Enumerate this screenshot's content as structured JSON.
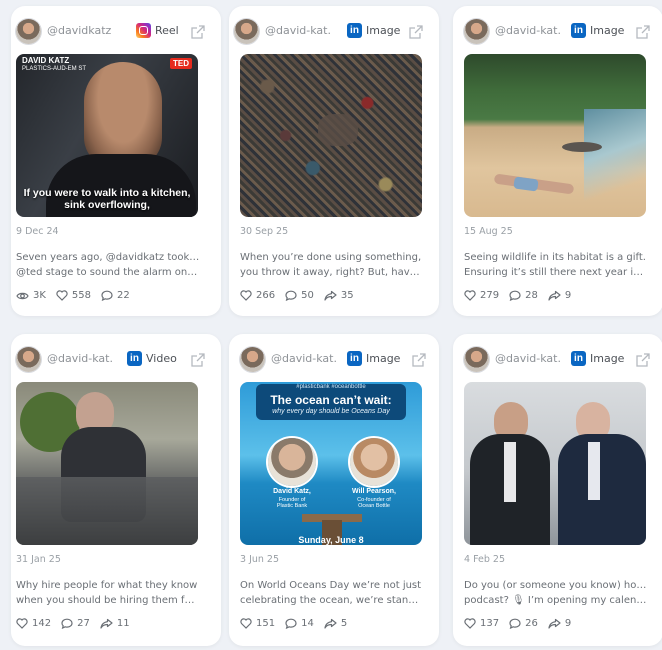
{
  "posts": [
    {
      "handle": "@davidkatz",
      "platform": "Reel",
      "platform_icon": "instagram-icon",
      "date": "9 Dec 24",
      "caption_lines": [
        "Seven years ago, @davidkatz took the",
        "@ted stage to sound the alarm on th..."
      ],
      "views": "3K",
      "likes": "558",
      "comments": "22",
      "media": {
        "speaker_name": "DAVID KATZ",
        "speaker_org": "PLASTICS-AUD-EM ST",
        "badge": "TED",
        "subtitle_lines": [
          "If you were to walk into a kitchen,",
          "sink overflowing,"
        ]
      }
    },
    {
      "handle": "@david-kat...",
      "platform": "Image",
      "platform_icon": "linkedin-icon",
      "date": "30 Sep 25",
      "caption_lines": [
        "When you’re done using something,",
        "you throw it away, right? But, have yo..."
      ],
      "likes": "266",
      "comments": "50",
      "shares": "35"
    },
    {
      "handle": "@david-kat...",
      "platform": "Image",
      "platform_icon": "linkedin-icon",
      "date": "15 Aug 25",
      "caption_lines": [
        "Seeing wildlife in its habitat is a gift.",
        "Ensuring it’s still there next year is our..."
      ],
      "likes": "279",
      "comments": "28",
      "shares": "9"
    },
    {
      "handle": "@david-kat...",
      "platform": "Video",
      "platform_icon": "linkedin-icon",
      "date": "31 Jan 25",
      "caption_lines": [
        "Why hire people for what they know",
        "when you should be hiring them for..."
      ],
      "likes": "142",
      "comments": "27",
      "shares": "11"
    },
    {
      "handle": "@david-kat...",
      "platform": "Image",
      "platform_icon": "linkedin-icon",
      "date": "3 Jun 25",
      "caption_lines": [
        "On World Oceans Day we’re not just",
        "celebrating the ocean, we’re standing..."
      ],
      "likes": "151",
      "comments": "14",
      "shares": "5",
      "media": {
        "header": "#plasticbank  #oceanbottle",
        "title": "The ocean can’t wait:",
        "subtitle": "why every day should be Oceans Day",
        "person1_name": "David Katz,",
        "person1_role_lines": [
          "Founder of",
          "Plastic Bank"
        ],
        "person2_name": "Will Pearson,",
        "person2_role_lines": [
          "Co-founder of",
          "Ocean Bottle"
        ],
        "bottom": "Sunday, June 8"
      }
    },
    {
      "handle": "@david-kat...",
      "platform": "Image",
      "platform_icon": "linkedin-icon",
      "date": "4 Feb 25",
      "caption_lines": [
        "Do you (or someone you know) host a",
        "podcast? 🎙 I’m opening my calenda..."
      ],
      "likes": "137",
      "comments": "26",
      "shares": "9"
    }
  ],
  "colors": {
    "page_bg": "#eef1f6",
    "card_bg": "#ffffff",
    "linkedin": "#0a66c2",
    "muted_text": "#9aa0a6",
    "body_text": "#6a6f75"
  }
}
